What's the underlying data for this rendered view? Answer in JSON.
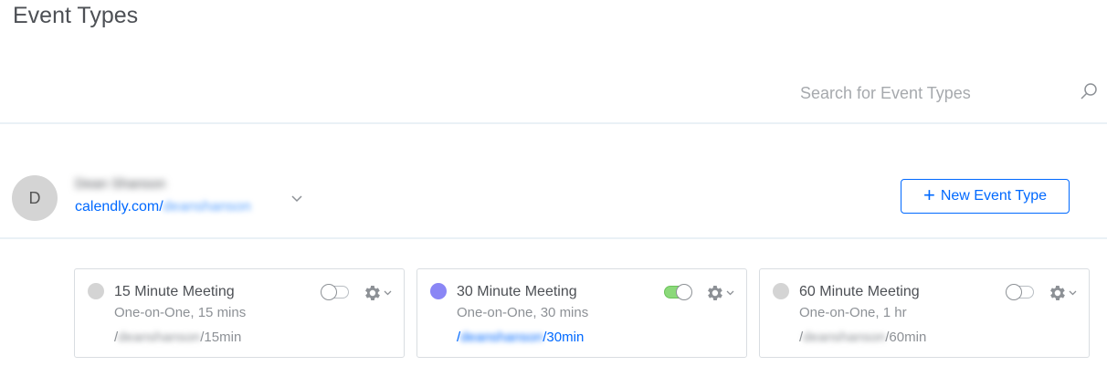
{
  "page": {
    "title": "Event Types"
  },
  "search": {
    "placeholder": "Search for Event Types"
  },
  "user": {
    "avatar_initial": "D",
    "name": "Dean Shanson",
    "link_prefix": "calendly.com/",
    "link_slug": "deanshanson"
  },
  "actions": {
    "new_event_label": "New Event Type",
    "new_event_icon": "plus-icon"
  },
  "cards": [
    {
      "title": "15 Minute Meeting",
      "subtitle": "One-on-One, 15 mins",
      "url_prefix": "/",
      "url_slug": "deanshanson",
      "url_suffix": "/15min",
      "color": "#d4d4d4",
      "enabled": false
    },
    {
      "title": "30 Minute Meeting",
      "subtitle": "One-on-One, 30 mins",
      "url_prefix": "/",
      "url_slug": "deanshanson",
      "url_suffix": "/30min",
      "color": "#8a86f5",
      "enabled": true
    },
    {
      "title": "60 Minute Meeting",
      "subtitle": "One-on-One, 1 hr",
      "url_prefix": "/",
      "url_slug": "deanshanson",
      "url_suffix": "/60min",
      "color": "#d4d4d4",
      "enabled": false
    }
  ],
  "colors": {
    "accent": "#0069ff",
    "toggle_on": "#8bd97a",
    "border": "#d9dde1"
  }
}
